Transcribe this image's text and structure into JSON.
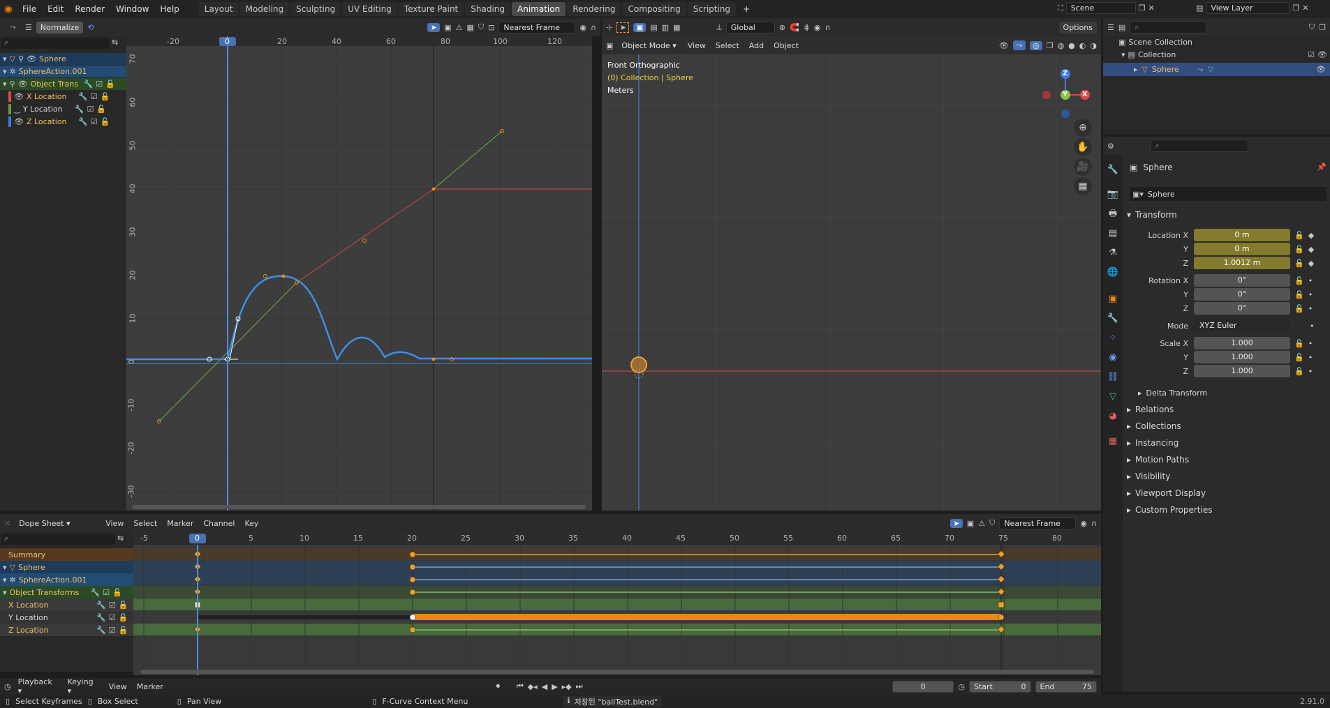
{
  "topbar": {
    "menus": [
      "File",
      "Edit",
      "Render",
      "Window",
      "Help"
    ],
    "workspaces": [
      "Layout",
      "Modeling",
      "Sculpting",
      "UV Editing",
      "Texture Paint",
      "Shading",
      "Animation",
      "Rendering",
      "Compositing",
      "Scripting"
    ],
    "active_workspace": "Animation",
    "plus": "+",
    "scene": "Scene",
    "view_layer": "View Layer"
  },
  "graph_editor": {
    "normalize": "Normalize",
    "snap": "Nearest Frame",
    "x_ticks": [
      "-20",
      "0",
      "20",
      "40",
      "60",
      "80",
      "100",
      "120"
    ],
    "y_ticks": [
      "70",
      "60",
      "50",
      "40",
      "30",
      "20",
      "10",
      "0",
      "-10",
      "-20",
      "-30"
    ],
    "current_frame": "0",
    "channels": {
      "object": "Sphere",
      "action": "SphereAction.001",
      "group": "Object Trans",
      "x": "X Location",
      "y": "Y Location",
      "z": "Z Location"
    }
  },
  "viewport": {
    "mode": "Object Mode",
    "menus": [
      "View",
      "Select",
      "Add",
      "Object"
    ],
    "orientation": "Global",
    "options": "Options",
    "view_name": "Front Orthographic",
    "collection_info": "(0) Collection | Sphere",
    "units": "Meters",
    "gizmo": {
      "z": "Z",
      "y": "Y",
      "x": "X"
    }
  },
  "outliner": {
    "scene_collection": "Scene Collection",
    "collection": "Collection",
    "object": "Sphere"
  },
  "properties": {
    "object_name": "Sphere",
    "object_field": "Sphere",
    "transform": "Transform",
    "location_label": "Location X",
    "rotation_label": "Rotation X",
    "scale_label": "Scale X",
    "y": "Y",
    "z": "Z",
    "loc": [
      "0 m",
      "0 m",
      "1.0012 m"
    ],
    "rot": [
      "0°",
      "0°",
      "0°"
    ],
    "mode_label": "Mode",
    "mode_value": "XYZ Euler",
    "scale": [
      "1.000",
      "1.000",
      "1.000"
    ],
    "delta": "Delta Transform",
    "panels": [
      "Relations",
      "Collections",
      "Instancing",
      "Motion Paths",
      "Visibility",
      "Viewport Display",
      "Custom Properties"
    ]
  },
  "dopesheet": {
    "mode": "Dope Sheet",
    "menus": [
      "View",
      "Select",
      "Marker",
      "Channel",
      "Key"
    ],
    "snap": "Nearest Frame",
    "ticks": [
      "-5",
      "0",
      "5",
      "10",
      "15",
      "20",
      "25",
      "30",
      "35",
      "40",
      "45",
      "50",
      "55",
      "60",
      "65",
      "70",
      "75",
      "80"
    ],
    "current_frame": "0",
    "rows": {
      "summary": "Summary",
      "object": "Sphere",
      "action": "SphereAction.001",
      "group": "Object Transforms",
      "x": "X Location",
      "y": "Y Location",
      "z": "Z Location"
    }
  },
  "timeline": {
    "menus": [
      "Playback",
      "Keying",
      "View",
      "Marker"
    ],
    "frame": "0",
    "start_label": "Start",
    "start": "0",
    "end_label": "End",
    "end": "75"
  },
  "statusbar": {
    "select": "Select Keyframes",
    "box": "Box Select",
    "pan": "Pan View",
    "context": "F-Curve Context Menu",
    "saved": "저장된 \"ballTest.blend\"",
    "version": "2.91.0"
  },
  "colors": {
    "accent": "#4772b3",
    "curve": "#3d8fe8",
    "keyframe": "#f08a12",
    "x_axis": "#d64545",
    "y_axis": "#8bc34a"
  }
}
